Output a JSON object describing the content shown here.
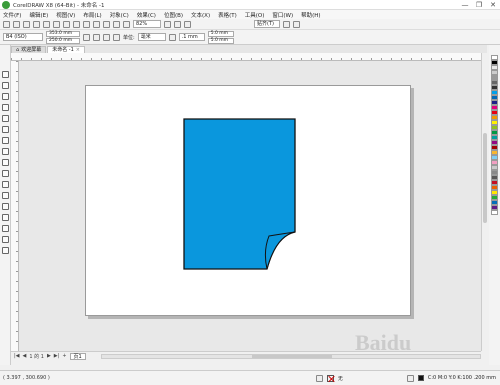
{
  "window": {
    "title": "CorelDRAW X8 (64-Bit) - 未命名 -1",
    "buttons": [
      "—",
      "❐",
      "✕"
    ]
  },
  "menu": [
    "文件(F)",
    "编辑(E)",
    "视图(V)",
    "布局(L)",
    "对象(C)",
    "效果(C)",
    "位图(B)",
    "文本(X)",
    "表格(T)",
    "工具(O)",
    "窗口(W)",
    "帮助(H)"
  ],
  "toolbar": {
    "zoom": "82%",
    "snap": "贴齐(T)"
  },
  "propbar": {
    "preset": "B4 (ISO)",
    "width": "353.0 mm",
    "height": "250.0 mm",
    "unit_label": "单位:",
    "unit": "毫米",
    "nudge": ".1 mm",
    "dup_x": "5.0 mm",
    "dup_y": "5.0 mm"
  },
  "tabs": [
    {
      "label": "欢迎屏幕",
      "active": false
    },
    {
      "label": "未命名 -1",
      "active": true
    }
  ],
  "pagebar": {
    "page_count": "1 的 1",
    "page_label": "页1"
  },
  "status": {
    "coords": "( 3.397 , 300.690 )",
    "fill_label": "无",
    "outline": "C:0 M:0 Y:0 K:100  .200 mm"
  },
  "shape": {
    "fill": "#0a97dd",
    "outline": "#111111"
  },
  "palette_colors": [
    "#ffffff",
    "#000000",
    "#e8e8e8",
    "#cccccc",
    "#999999",
    "#666666",
    "#333333",
    "#00a0e9",
    "#0068b7",
    "#1d2088",
    "#e4007f",
    "#e60012",
    "#f39800",
    "#fff100",
    "#8fc31f",
    "#009944",
    "#00a0a0",
    "#920783",
    "#a40000",
    "#f8b62d",
    "#7ecef4",
    "#f19ec2",
    "#c9caca",
    "#898989",
    "#595757",
    "#c30d23",
    "#eb6100",
    "#ffe600",
    "#22ac38",
    "#036eb8",
    "#601986",
    "#ffffff"
  ],
  "watermark": "Baidu"
}
